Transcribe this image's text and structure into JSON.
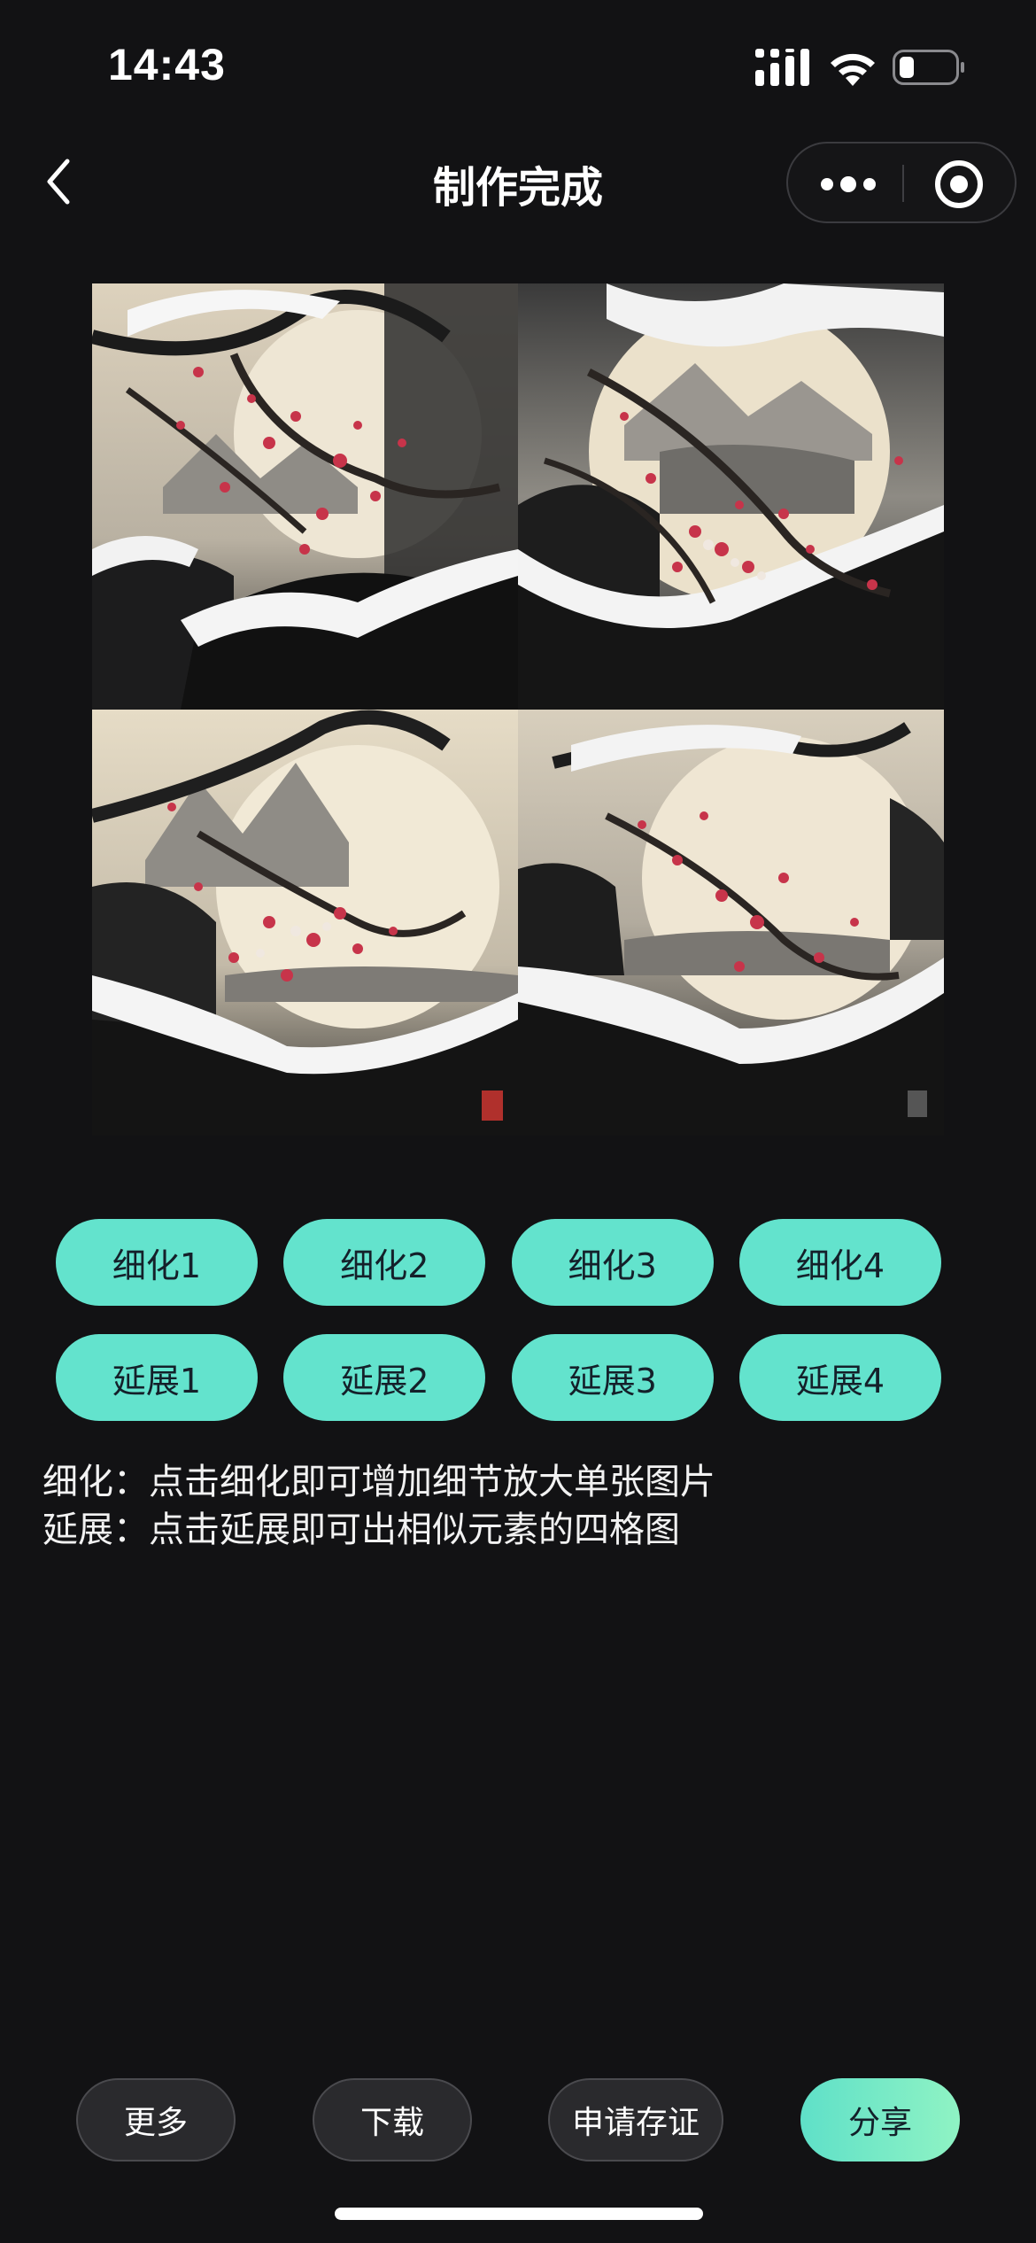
{
  "status_bar": {
    "time": "14:43",
    "icons": [
      "signal-icon",
      "wifi-icon",
      "battery-icon"
    ]
  },
  "header": {
    "title": "制作完成",
    "back_icon": "chevron-left-icon",
    "capsule_icons": [
      "more-dots-icon",
      "close-target-icon"
    ]
  },
  "refine_buttons": [
    {
      "label": "细化1"
    },
    {
      "label": "细化2"
    },
    {
      "label": "细化3"
    },
    {
      "label": "细化4"
    }
  ],
  "extend_buttons": [
    {
      "label": "延展1"
    },
    {
      "label": "延展2"
    },
    {
      "label": "延展3"
    },
    {
      "label": "延展4"
    }
  ],
  "description": {
    "line1": "细化：点击细化即可增加细节放大单张图片",
    "line2": "延展：点击延展即可出相似元素的四格图"
  },
  "bottom_bar": {
    "more": "更多",
    "download": "下载",
    "certify": "申请存证",
    "share": "分享"
  },
  "colors": {
    "background": "#121214",
    "accent": "#63e3cd",
    "pill_text": "#14202a",
    "button_dark": "#2a2a2d"
  }
}
